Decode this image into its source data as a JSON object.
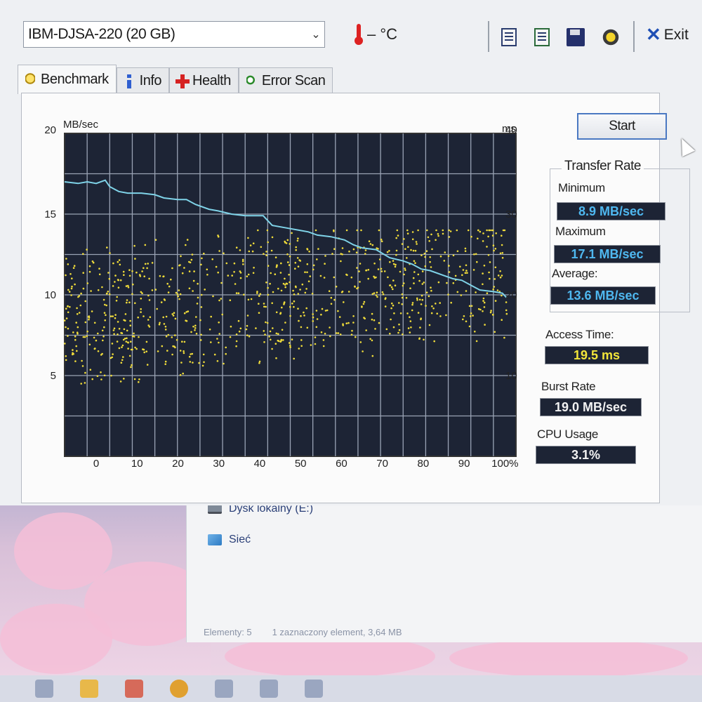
{
  "app": {
    "drive": "IBM-DJSA-220 (20 GB)",
    "temperature": "– °C",
    "exit_label": "Exit"
  },
  "tabs": [
    {
      "label": "Benchmark",
      "icon": "bulb-icon",
      "active": true
    },
    {
      "label": "Info",
      "icon": "info-icon",
      "active": false
    },
    {
      "label": "Health",
      "icon": "health-cross-icon",
      "active": false
    },
    {
      "label": "Error Scan",
      "icon": "magnifier-icon",
      "active": false
    }
  ],
  "toolbar_icons": [
    "copy-text-icon",
    "copy-screenshot-icon",
    "save-icon",
    "options-gear-icon"
  ],
  "benchmark": {
    "start_label": "Start",
    "transfer_rate_title": "Transfer Rate",
    "minimum_label": "Minimum",
    "minimum_value": "8.9 MB/sec",
    "maximum_label": "Maximum",
    "maximum_value": "17.1 MB/sec",
    "average_label": "Average:",
    "average_value": "13.6 MB/sec",
    "access_time_label": "Access Time:",
    "access_time_value": "19.5 ms",
    "burst_rate_label": "Burst Rate",
    "burst_rate_value": "19.0 MB/sec",
    "cpu_usage_label": "CPU Usage",
    "cpu_usage_value": "3.1%"
  },
  "chart_data": {
    "type": "line",
    "xlabel": "",
    "ylabel": "MB/sec",
    "y2label": "ms",
    "xlim": [
      0,
      100
    ],
    "ylim": [
      0,
      20
    ],
    "y2lim": [
      0,
      40
    ],
    "x_ticks": [
      "0",
      "10",
      "20",
      "30",
      "40",
      "50",
      "60",
      "70",
      "80",
      "90",
      "100%"
    ],
    "y_ticks": [
      "5",
      "10",
      "15",
      "20"
    ],
    "y2_ticks": [
      "10",
      "20",
      "30",
      "40"
    ],
    "grid": true,
    "colors": {
      "background": "#1d2435",
      "grid": "#9aa3b5",
      "transfer": "#7fd3e8",
      "access": "#f0dc3a"
    },
    "series": [
      {
        "name": "",
        "x": [
          0,
          3,
          5,
          7,
          9,
          10,
          12,
          14,
          17,
          20,
          22,
          25,
          27,
          29,
          32,
          34,
          37,
          40,
          44,
          46,
          50,
          52,
          54,
          56,
          59,
          62,
          64,
          66,
          69,
          72,
          75,
          77,
          79,
          81,
          84,
          86,
          88,
          90,
          92,
          95,
          97,
          98
        ],
        "y": [
          17.0,
          16.9,
          17.0,
          16.9,
          17.1,
          16.7,
          16.4,
          16.3,
          16.3,
          16.2,
          16.0,
          15.9,
          15.9,
          15.6,
          15.3,
          15.2,
          15.0,
          14.9,
          14.9,
          14.3,
          14.1,
          14.0,
          13.9,
          13.7,
          13.6,
          13.4,
          13.1,
          12.9,
          12.8,
          12.3,
          12.1,
          11.9,
          11.6,
          11.5,
          11.2,
          11.0,
          10.9,
          10.6,
          10.3,
          10.2,
          10.1,
          9.8
        ]
      },
      {
        "name": "",
        "type": "scatter",
        "x_range": [
          0,
          98
        ],
        "y2_range": [
          9,
          28
        ]
      }
    ]
  },
  "explorer": {
    "items": [
      {
        "label": "Dysk lokalny (E:)",
        "icon": "drive-icon"
      },
      {
        "label": "Sieć",
        "icon": "network-icon"
      }
    ],
    "status_count": "Elementy: 5",
    "status_selection": "1 zaznaczony element, 3,64 MB"
  }
}
